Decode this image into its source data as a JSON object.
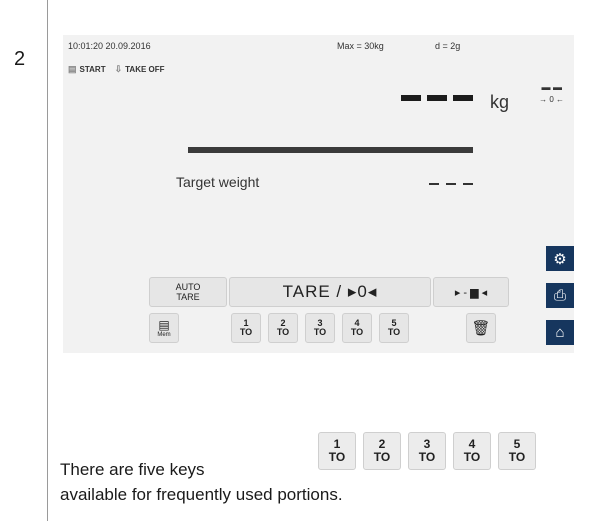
{
  "step_number": "2",
  "screen": {
    "datetime": "10:01:20 20.09.2016",
    "max": "Max = 30kg",
    "d": "d = 2g",
    "start_label": "START",
    "takeoff_label": "TAKE OFF",
    "zero_indicator": "→ 0 ←",
    "stable_indicator": "▬ ▬",
    "unit": "kg",
    "target_label": "Target weight",
    "buttons": {
      "auto_tare": [
        "AUTO",
        "TARE"
      ],
      "tare_zero": "TARE / ▸0◂",
      "container": "▸ - ▆ ◂",
      "mem": "Mem"
    },
    "portion_keys": [
      {
        "num": "1",
        "label": "TO"
      },
      {
        "num": "2",
        "label": "TO"
      },
      {
        "num": "3",
        "label": "TO"
      },
      {
        "num": "4",
        "label": "TO"
      },
      {
        "num": "5",
        "label": "TO"
      }
    ],
    "side_icons": [
      "gear-icon",
      "printer-icon",
      "home-icon"
    ]
  },
  "caption": {
    "line1": "There are five keys",
    "line2": "available for frequently used portions."
  },
  "caption_keys": [
    {
      "num": "1",
      "label": "TO"
    },
    {
      "num": "2",
      "label": "TO"
    },
    {
      "num": "3",
      "label": "TO"
    },
    {
      "num": "4",
      "label": "TO"
    },
    {
      "num": "5",
      "label": "TO"
    }
  ]
}
